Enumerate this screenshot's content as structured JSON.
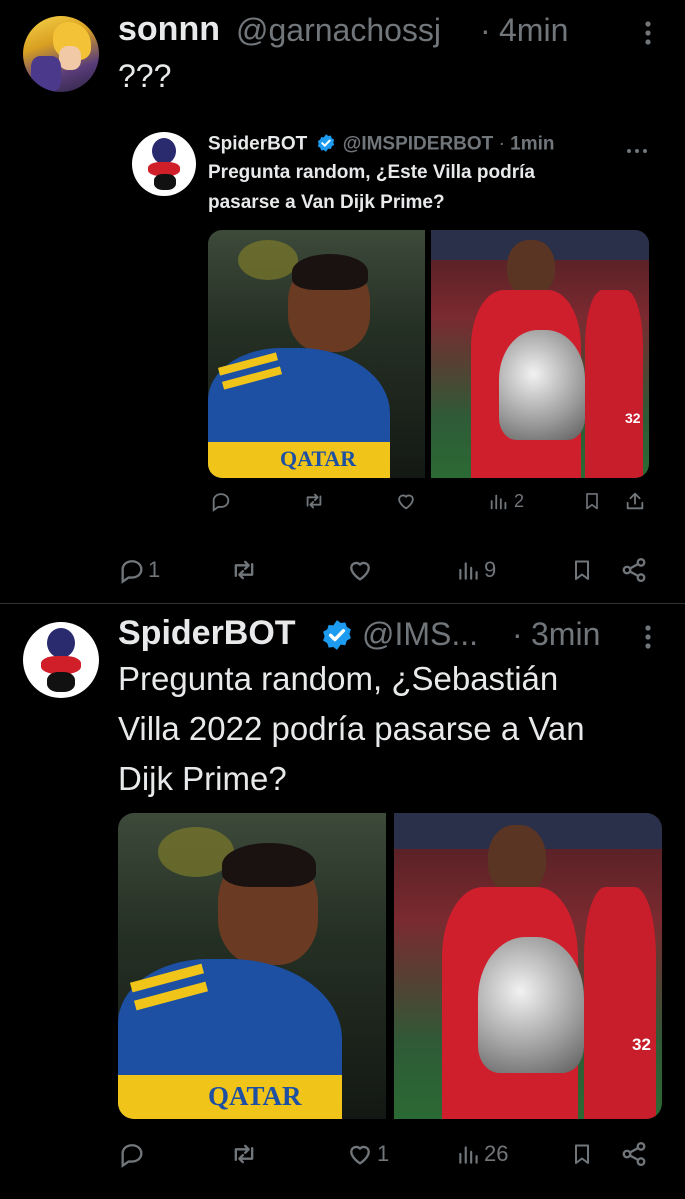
{
  "tweet1": {
    "display_name": "sonnn",
    "handle": "@garnachossj",
    "dot": "·",
    "time": "4min",
    "text": "???",
    "quoted": {
      "display_name": "SpiderBOT",
      "handle": "@IMSPIDERBOT",
      "dot": "·",
      "time": "1min",
      "text_line1": "Pregunta random, ¿Este Villa podría",
      "text_line2": "pasarse a Van Dijk Prime?",
      "views": "2"
    },
    "replies": "1",
    "views": "9"
  },
  "tweet2": {
    "display_name": "SpiderBOT",
    "handle": "@IMS...",
    "dot": "·",
    "time": "3min",
    "text_line1": "Pregunta random, ¿Sebastián",
    "text_line2": "Villa 2022 podría pasarse a Van",
    "text_line3": "Dijk Prime?",
    "likes": "1",
    "views": "26"
  },
  "image_text": {
    "jersey": "QATAR",
    "shorts_number": "32"
  },
  "colors": {
    "background": "#000000",
    "text": "#e7e9ea",
    "muted": "#71767b",
    "verified": "#1d9bf0",
    "divider": "#2f3336"
  }
}
